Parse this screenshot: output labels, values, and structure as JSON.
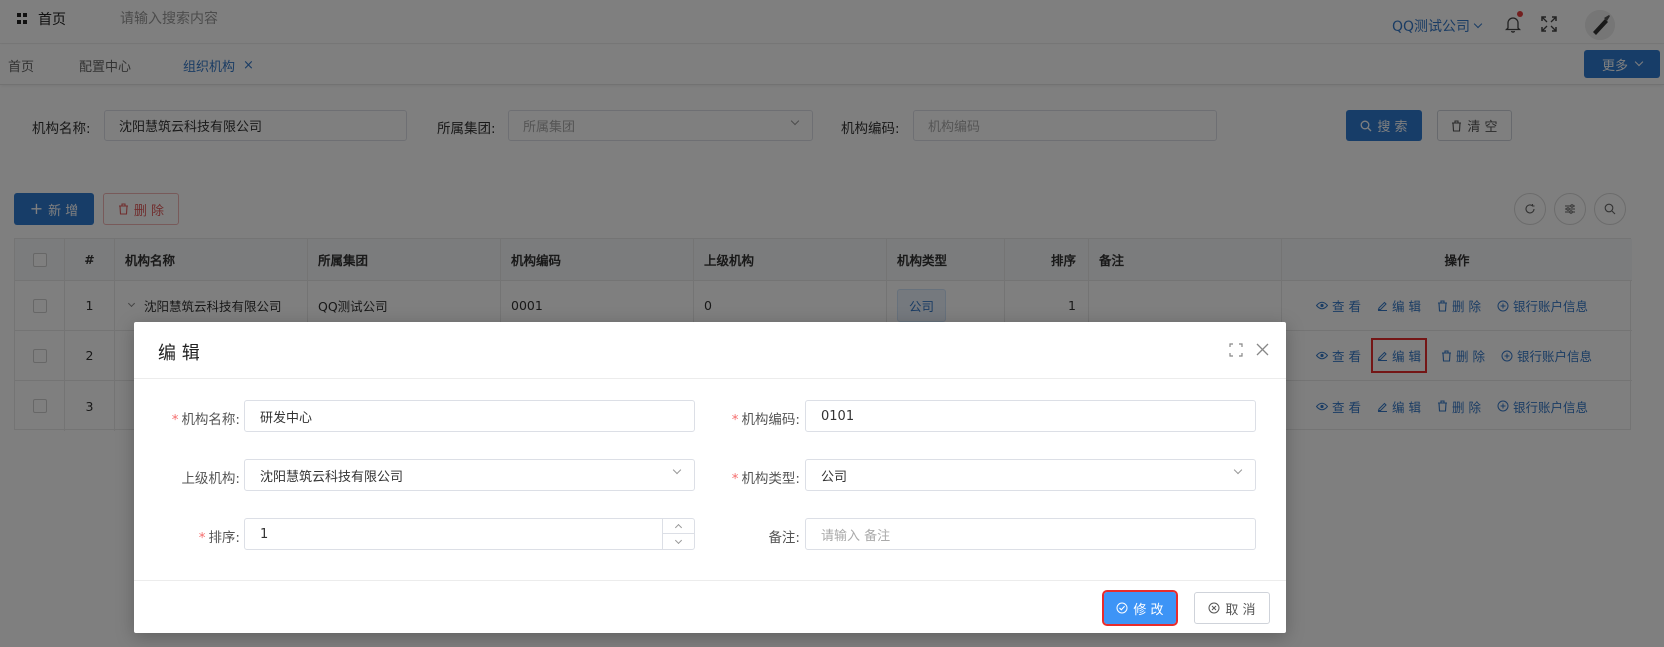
{
  "header": {
    "home_label": "首页",
    "search_placeholder": "请输入搜索内容",
    "company": "QQ测试公司"
  },
  "tabs": [
    {
      "label": "首页"
    },
    {
      "label": "配置中心"
    },
    {
      "label": "组织机构",
      "close": "×"
    }
  ],
  "more_label": "更多",
  "filter": {
    "name_label": "机构名称:",
    "name_value": "沈阳慧筑云科技有限公司",
    "group_label": "所属集团:",
    "group_placeholder": "所属集团",
    "code_label": "机构编码:",
    "code_placeholder": "机构编码",
    "search_label": "搜 索",
    "clear_label": "清 空"
  },
  "toolbar": {
    "add_label": "新 增",
    "delete_label": "删 除"
  },
  "table": {
    "columns": [
      "#",
      "机构名称",
      "所属集团",
      "机构编码",
      "上级机构",
      "机构类型",
      "排序",
      "备注",
      "操作"
    ],
    "rows": [
      {
        "index": "1",
        "name": "沈阳慧筑云科技有限公司",
        "group": "QQ测试公司",
        "code": "0001",
        "parent": "0",
        "type": "公司",
        "sort": "1",
        "remark": ""
      },
      {
        "index": "2"
      },
      {
        "index": "3"
      }
    ],
    "ops": {
      "view": "查 看",
      "edit": "编 辑",
      "delete": "删 除",
      "bank": "银行账户信息"
    }
  },
  "modal": {
    "title": "编 辑",
    "fields": {
      "name_label": "机构名称:",
      "name_value": "研发中心",
      "code_label": "机构编码:",
      "code_value": "0101",
      "parent_label": "上级机构:",
      "parent_value": "沈阳慧筑云科技有限公司",
      "type_label": "机构类型:",
      "type_value": "公司",
      "sort_label": "排序:",
      "sort_value": "1",
      "remark_label": "备注:",
      "remark_placeholder": "请输入 备注"
    },
    "submit_label": "修 改",
    "cancel_label": "取 消"
  },
  "colors": {
    "primary": "#2f7bd1",
    "link": "#3478c8",
    "danger": "#e05c5c",
    "highlight": "#e82c2c"
  }
}
